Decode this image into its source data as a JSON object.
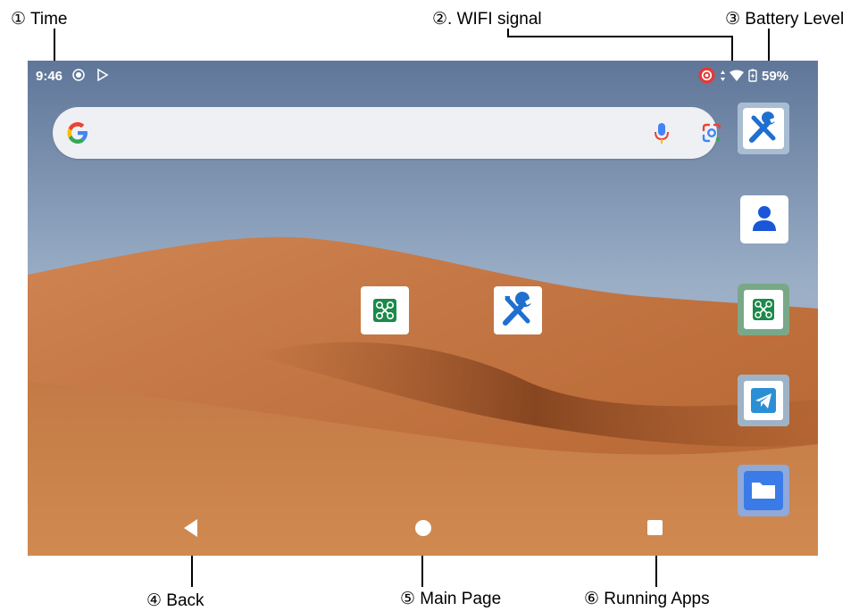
{
  "callouts": {
    "time": "① Time",
    "wifi": "②. WIFI signal",
    "battery": "③ Battery Level",
    "back": "④ Back",
    "main_page": "⑤ Main Page",
    "running_apps": "⑥ Running Apps"
  },
  "status_bar": {
    "time": "9:46",
    "battery_percent": "59%",
    "icons": [
      "screen-record-icon",
      "play-store-icon",
      "cast-icon",
      "mobile-data-icon",
      "wifi-icon",
      "battery-icon"
    ]
  },
  "search_bar": {
    "icons": [
      "google-g-logo",
      "microphone-icon",
      "google-lens-icon"
    ]
  },
  "home_apps": [
    {
      "name": "drone-app",
      "icon": "drone-icon",
      "color": "#1b8a4a"
    },
    {
      "name": "tools-app",
      "icon": "wrench-screwdriver-icon",
      "color": "#1f6fd0"
    }
  ],
  "dock_apps": [
    {
      "name": "tools-app",
      "icon": "wrench-screwdriver-icon",
      "color": "#1f6fd0"
    },
    {
      "name": "contacts-app",
      "icon": "person-icon",
      "color": "#1a57d8"
    },
    {
      "name": "drone-app",
      "icon": "drone-icon",
      "color": "#1b8a4a"
    },
    {
      "name": "telegram-app",
      "icon": "paper-plane-icon",
      "color": "#2b8fd6"
    },
    {
      "name": "files-app",
      "icon": "folder-icon",
      "color": "#3b7be8"
    }
  ],
  "nav_bar": {
    "buttons": [
      "back-button",
      "home-button",
      "recents-button"
    ]
  }
}
